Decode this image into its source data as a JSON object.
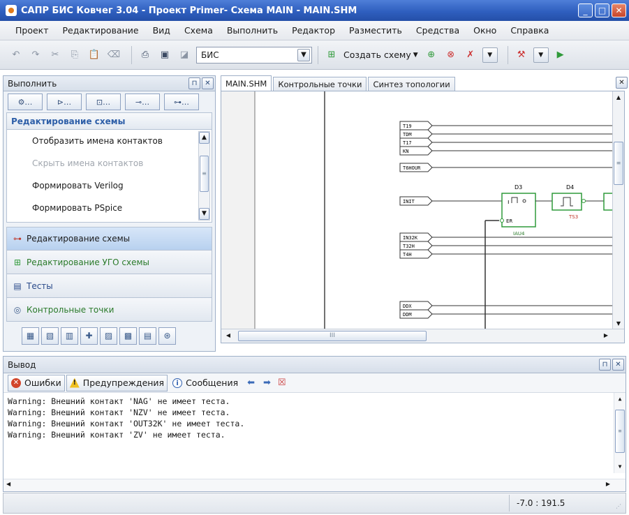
{
  "window": {
    "title": "САПР БИС Ковчег 3.04 - Проект Primer- Схема MAIN - MAIN.SHM"
  },
  "menu": [
    "Проект",
    "Редактирование",
    "Вид",
    "Схема",
    "Выполнить",
    "Редактор",
    "Разместить",
    "Средства",
    "Окно",
    "Справка"
  ],
  "toolbar": {
    "combo_value": "БИС",
    "create_scheme": "Создать схему"
  },
  "left_panel": {
    "title": "Выполнить",
    "section_title": "Редактирование схемы",
    "commands": [
      {
        "label": "Отобразить имена контактов",
        "enabled": true
      },
      {
        "label": "Скрыть имена контактов",
        "enabled": false
      },
      {
        "label": "Формировать Verilog",
        "enabled": true
      },
      {
        "label": "Формировать PSpice",
        "enabled": true
      }
    ],
    "nav": [
      {
        "label": "Редактирование схемы",
        "icon": "scheme-edit-icon",
        "active": true
      },
      {
        "label": "Редактирование УГО схемы",
        "icon": "symbol-edit-icon",
        "active": false
      },
      {
        "label": "Тесты",
        "icon": "tests-icon",
        "active": false
      },
      {
        "label": "Контрольные точки",
        "icon": "checkpoints-icon",
        "active": false
      }
    ]
  },
  "tabs": [
    "MAIN.SHM",
    "Контрольные точки",
    "Синтез топологии"
  ],
  "schematic": {
    "ports": [
      "T19",
      "TDM",
      "T17",
      "KN",
      "T6HOUR",
      "INIT",
      "IN32K",
      "T32H",
      "T4H",
      "DDX",
      "DDM"
    ],
    "d3": {
      "name": "D3",
      "pin": "ER",
      "ref": "IAU4"
    },
    "d4": {
      "name": "D4",
      "ref": "TS3"
    },
    "hscroll_grip": "III"
  },
  "output": {
    "title": "Вывод",
    "filters": {
      "errors": "Ошибки",
      "warnings": "Предупреждения",
      "messages": "Сообщения"
    },
    "lines": [
      "Warning: Внешний контакт 'NAG' не имеет теста.",
      "Warning: Внешний контакт 'NZV' не имеет теста.",
      "Warning: Внешний контакт 'OUT32K' не имеет теста.",
      "Warning: Внешний контакт 'ZV' не имеет теста."
    ]
  },
  "status": {
    "coords": "-7.0 : 191.5"
  },
  "colors": {
    "title_bar": "#2f5fbf",
    "accent_text": "#2e5fa8",
    "schematic_green": "#2f9a3a",
    "port_fill": "#ffffff"
  }
}
